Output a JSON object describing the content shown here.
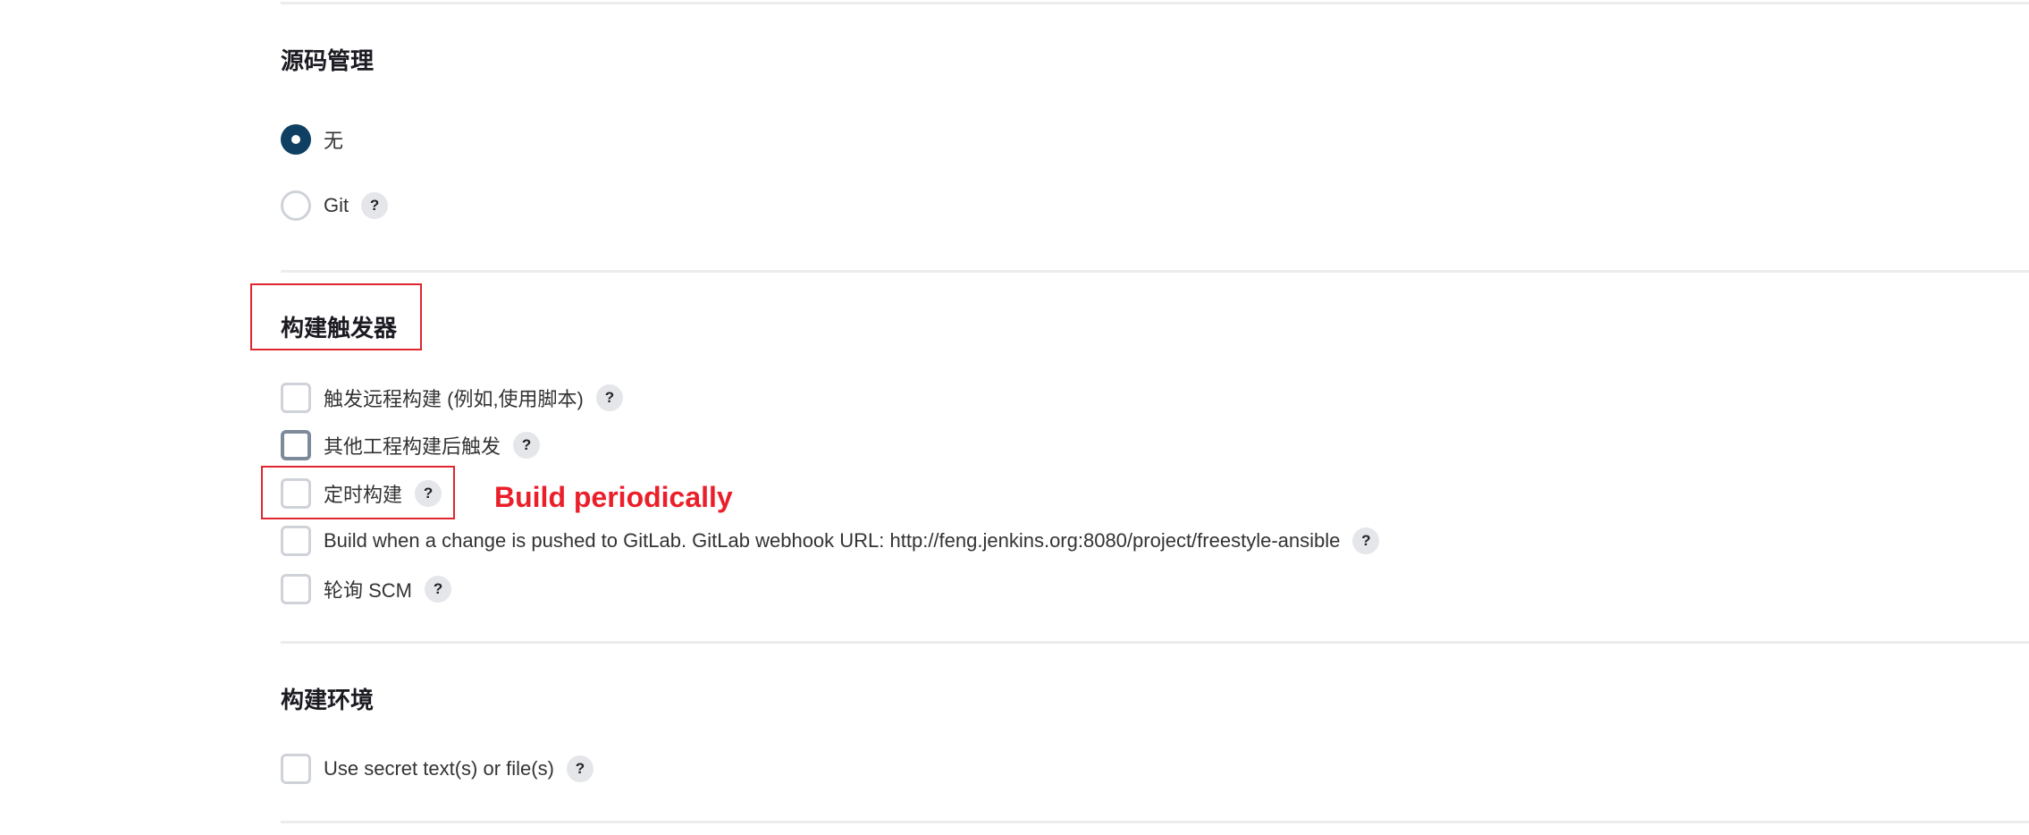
{
  "scm": {
    "title": "源码管理",
    "options": [
      {
        "label": "无",
        "selected": true
      },
      {
        "label": "Git",
        "selected": false
      }
    ]
  },
  "build_triggers": {
    "title": "构建触发器",
    "options": [
      {
        "label": "触发远程构建 (例如,使用脚本)",
        "checked": false
      },
      {
        "label": "其他工程构建后触发",
        "checked": false
      },
      {
        "label": "定时构建",
        "checked": false
      },
      {
        "label": "Build when a change is pushed to GitLab. GitLab webhook URL: http://feng.jenkins.org:8080/project/freestyle-ansible",
        "checked": false
      },
      {
        "label": "轮询 SCM",
        "checked": false
      }
    ]
  },
  "build_environment": {
    "title": "构建环境",
    "options": [
      {
        "label": "Use secret text(s) or file(s)",
        "checked": false
      }
    ]
  },
  "help_label": "?",
  "annotation": {
    "text": "Build periodically",
    "color": "#ea1f2a"
  },
  "colors": {
    "radio_selected": "#0f3f63",
    "control_border": "#cfd3d9",
    "help_bg": "#e4e6ea",
    "annotation_red": "#e0262f"
  }
}
